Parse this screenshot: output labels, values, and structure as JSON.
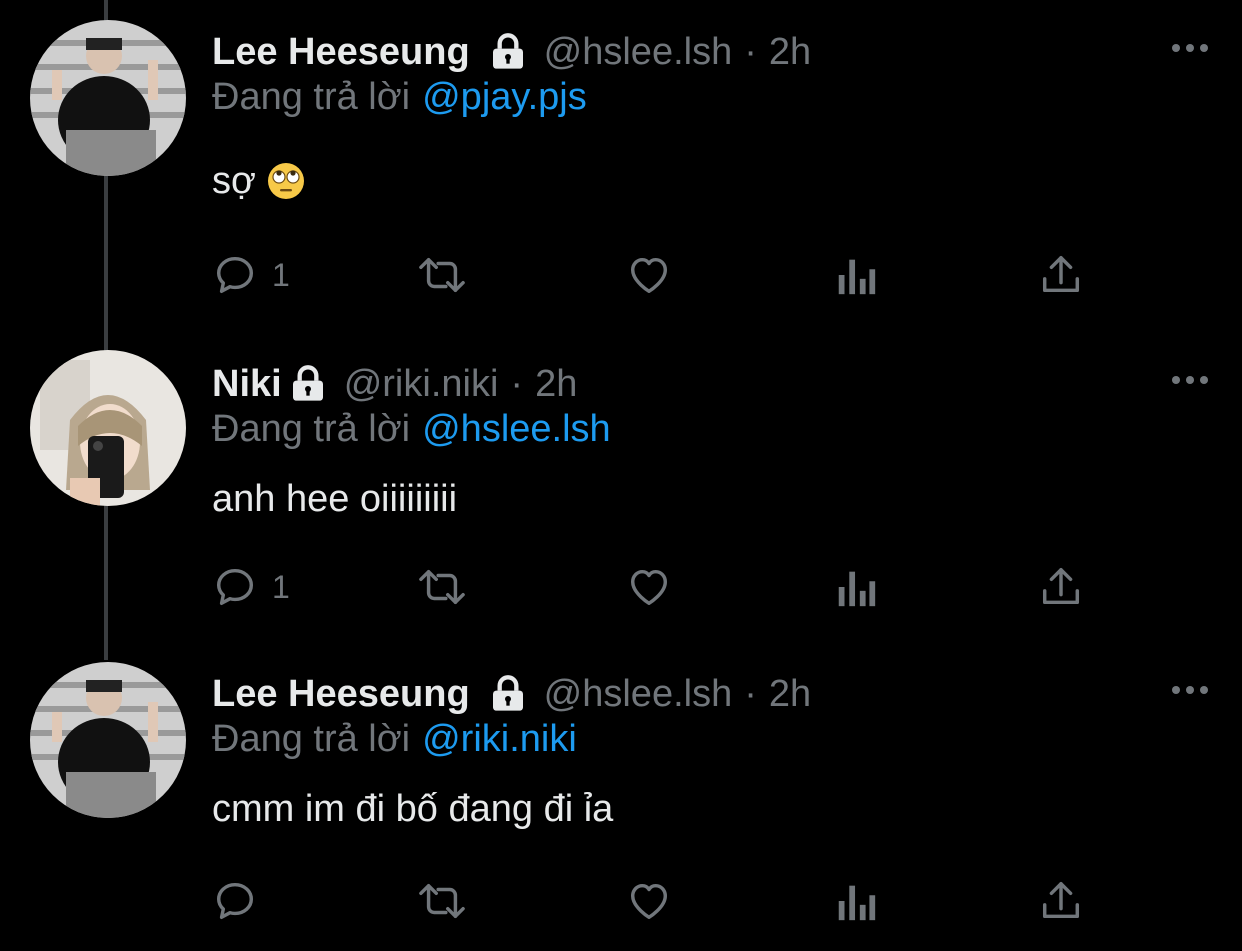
{
  "tweets": [
    {
      "name": "Lee Heeseung",
      "handle": "@hslee.lsh",
      "separator": "·",
      "time": "2h",
      "reply_prefix": "Đang trả lời",
      "reply_to": "@pjay.pjs",
      "text": "sợ",
      "emoji": "face-with-rolling-eyes",
      "reply_count": "1",
      "protected": true
    },
    {
      "name": "Niki",
      "handle": "@riki.niki",
      "separator": "·",
      "time": "2h",
      "reply_prefix": "Đang trả lời",
      "reply_to": "@hslee.lsh",
      "text": "anh hee oiiiiiiiii",
      "reply_count": "1",
      "protected": true
    },
    {
      "name": "Lee Heeseung",
      "handle": "@hslee.lsh",
      "separator": "·",
      "time": "2h",
      "reply_prefix": "Đang trả lời",
      "reply_to": "@riki.niki",
      "text": "cmm im đi bố đang đi ỉa",
      "reply_count": "",
      "protected": true
    }
  ],
  "icons": {
    "lock": "lock-icon",
    "more": "more-icon",
    "reply": "reply-icon",
    "retweet": "retweet-icon",
    "like": "like-icon",
    "views": "views-icon",
    "share": "share-icon"
  },
  "colors": {
    "background": "#000000",
    "primary_text": "#e7e9ea",
    "secondary_text": "#71767b",
    "link": "#1d9bf0",
    "thread_line": "#3a3d40"
  }
}
